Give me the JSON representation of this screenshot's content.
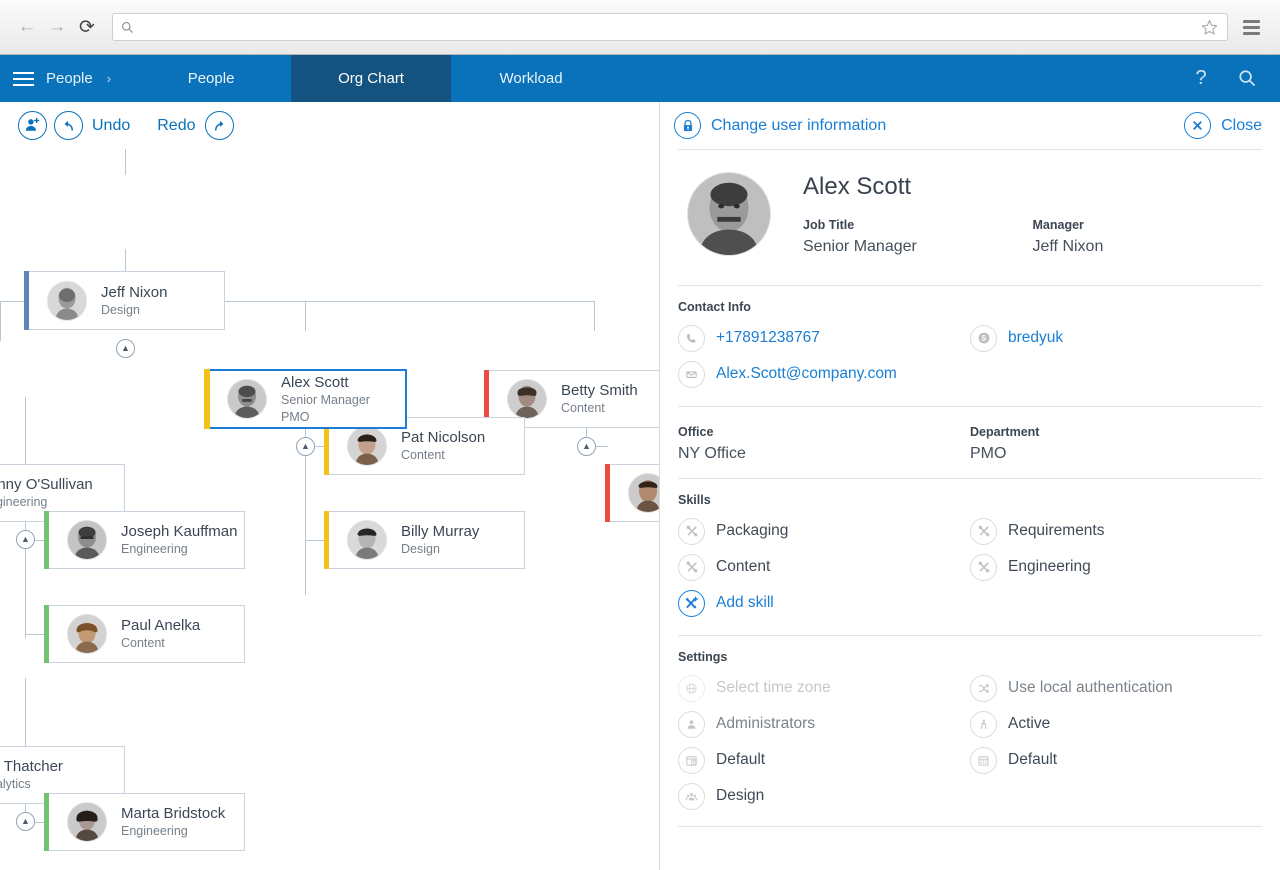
{
  "browser": {
    "back_icon": "arrow-left-icon",
    "forward_icon": "arrow-right-icon",
    "reload_icon": "reload-icon",
    "search_icon": "search-icon",
    "url_value": "",
    "url_placeholder": "",
    "bookmark_icon": "star-icon",
    "menu_icon": "hamburger-menu-icon"
  },
  "appnav": {
    "menu_icon": "hamburger-menu-icon",
    "brand": "People",
    "brand_chevron": "›",
    "tabs": [
      {
        "label": "People",
        "selected": false
      },
      {
        "label": "Org Chart",
        "selected": true
      },
      {
        "label": "Workload",
        "selected": false
      }
    ],
    "help_icon": "question-mark-icon",
    "search_icon": "search-icon",
    "bg_color": "#0a72ba",
    "selected_bg_color": "#14537f"
  },
  "toolbar": {
    "add_person_icon": "add-person-icon",
    "undo_icon": "undo-arrow-icon",
    "undo_label": "Undo",
    "redo_label": "Redo",
    "redo_icon": "redo-arrow-icon"
  },
  "orgchart": {
    "accent_colors": {
      "design_blue": "#5b86b5",
      "pmo_yellow": "#f2c21a",
      "content_red": "#ea4b43",
      "engineering_green": "#72c472"
    },
    "selection_color": "#1a7fd4",
    "connector_color": "#b9c6d4",
    "collapse_icon": "chevron-up-icon",
    "nodes": [
      {
        "id": "jeff",
        "name": "Jeff Nixon",
        "role": "Design",
        "dept": "",
        "accent": "#5b86b5",
        "selected": false
      },
      {
        "id": "alex",
        "name": "Alex Scott",
        "role": "Senior Manager",
        "dept": "PMO",
        "accent": "#f2c21a",
        "selected": true
      },
      {
        "id": "betty",
        "name": "Betty Smith",
        "role": "Content",
        "dept": "",
        "accent": "#ea4b43",
        "selected": false
      },
      {
        "id": "osull",
        "name": "onny O'Sullivan",
        "role": "ngineering",
        "dept": "",
        "accent": "#c9d4de",
        "selected": false
      },
      {
        "id": "pat",
        "name": "Pat Nicolson",
        "role": "Content",
        "dept": "",
        "accent": "#f2c21a",
        "selected": false
      },
      {
        "id": "joseph",
        "name": "Joseph Kauffman",
        "role": "Engineering",
        "dept": "",
        "accent": "#72c472",
        "selected": false
      },
      {
        "id": "billy",
        "name": "Billy Murray",
        "role": "Design",
        "dept": "",
        "accent": "#f2c21a",
        "selected": false
      },
      {
        "id": "paul",
        "name": "Paul Anelka",
        "role": "Content",
        "dept": "",
        "accent": "#72c472",
        "selected": false
      },
      {
        "id": "thatch",
        "name": "ly Thatcher",
        "role": "nalytics",
        "dept": "",
        "accent": "#c9d4de",
        "selected": false
      },
      {
        "id": "marta",
        "name": "Marta Bridstock",
        "role": "Engineering",
        "dept": "",
        "accent": "#72c472",
        "selected": false
      },
      {
        "id": "clipped",
        "name": "",
        "role": "",
        "dept": "",
        "accent": "#ea4b43",
        "selected": false
      }
    ]
  },
  "detail": {
    "edit_icon": "lock-icon",
    "edit_label": "Change user information",
    "close_icon": "close-x-icon",
    "close_label": "Close",
    "person": {
      "avatar_icon": "user-photo",
      "name": "Alex Scott",
      "job_title_label": "Job Title",
      "job_title_value": "Senior Manager",
      "manager_label": "Manager",
      "manager_value": "Jeff Nixon"
    },
    "contact": {
      "title": "Contact Info",
      "items": [
        {
          "icon": "phone-icon",
          "value": "+17891238767",
          "style": "blue"
        },
        {
          "icon": "skype-icon",
          "value": "bredyuk",
          "style": "blue"
        },
        {
          "icon": "email-icon",
          "value": "Alex.Scott@company.com",
          "style": "blue"
        }
      ]
    },
    "office": {
      "office_label": "Office",
      "office_value": "NY Office",
      "department_label": "Department",
      "department_value": "PMO"
    },
    "skills": {
      "title": "Skills",
      "items": [
        {
          "icon": "tools-icon",
          "label": "Packaging",
          "style": "dark"
        },
        {
          "icon": "tools-icon",
          "label": "Requirements",
          "style": "dark"
        },
        {
          "icon": "tools-icon",
          "label": "Content",
          "style": "dark"
        },
        {
          "icon": "tools-icon",
          "label": "Engineering",
          "style": "dark"
        }
      ],
      "add_icon": "add-tools-icon",
      "add_label": "Add skill"
    },
    "settings": {
      "title": "Settings",
      "items": [
        {
          "icon": "globe-icon",
          "label": "Select time zone",
          "style": "faint"
        },
        {
          "icon": "shuffle-icon",
          "label": "Use local authentication",
          "style": "muted"
        },
        {
          "icon": "person-icon",
          "label": "Administrators",
          "style": "muted"
        },
        {
          "icon": "walk-icon",
          "label": "Active",
          "style": "dark"
        },
        {
          "icon": "clock-icon",
          "label": "Default",
          "style": "dark"
        },
        {
          "icon": "calendar-icon",
          "label": "Default",
          "style": "dark"
        },
        {
          "icon": "group-icon",
          "label": "Design",
          "style": "dark"
        }
      ]
    }
  }
}
